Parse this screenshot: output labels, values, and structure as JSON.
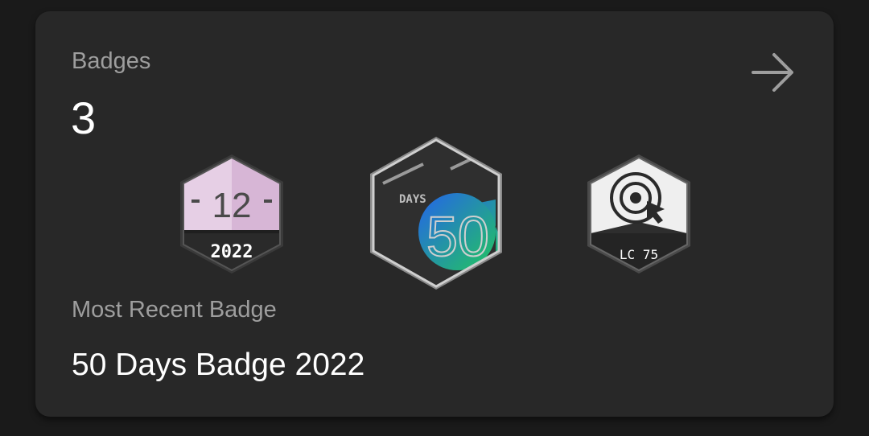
{
  "badges_card": {
    "title": "Badges",
    "count": "3",
    "badges": [
      {
        "name": "12 2022",
        "top_text": "12",
        "bottom_text": "2022"
      },
      {
        "name": "50 Days Badge 2022",
        "top_text": "DAYS",
        "bottom_text": "50"
      },
      {
        "name": "LC 75",
        "bottom_text": "LC 75"
      }
    ],
    "recent_label": "Most Recent Badge",
    "recent_value": "50 Days Badge 2022"
  },
  "colors": {
    "background": "#1a1a1a",
    "card": "#282828",
    "muted_text": "#9e9e9e",
    "text": "#ffffff",
    "badge_pink": "#e6cfe5",
    "badge_green": "#22c55e",
    "badge_blue": "#2563eb"
  },
  "icons": {
    "arrow": "arrow-right-icon",
    "target": "target-cursor-icon"
  }
}
